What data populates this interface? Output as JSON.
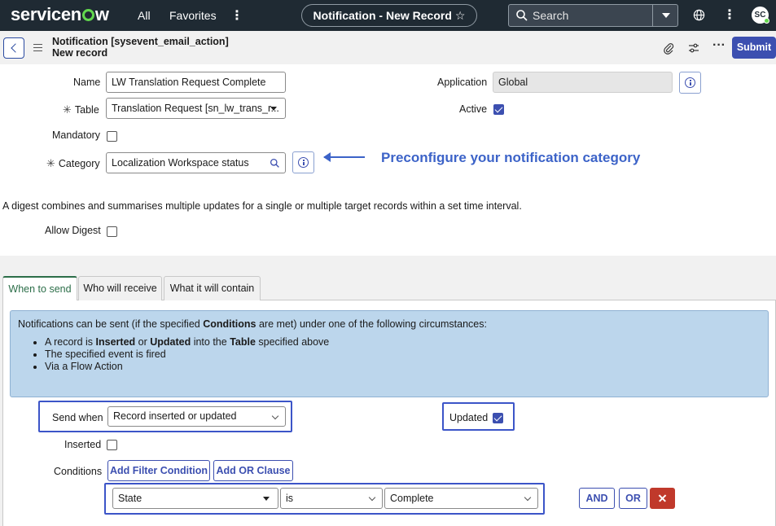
{
  "topnav": {
    "logo": "servicenow",
    "all": "All",
    "favorites": "Favorites",
    "more": "⋮",
    "page_title": "Notification - New Record",
    "search_label": "Search",
    "avatar_initials": "SC"
  },
  "header": {
    "table_label": "Notification [sysevent_email_action]",
    "record_label": "New record",
    "more": "···",
    "submit": "Submit"
  },
  "form": {
    "name_label": "Name",
    "name_value": "LW Translation Request Complete",
    "table_label": "Table",
    "table_value": "Translation Request [sn_lw_trans_r...",
    "application_label": "Application",
    "application_value": "Global",
    "active_label": "Active",
    "active_checked": true,
    "mandatory_label": "Mandatory",
    "mandatory_checked": false,
    "category_label": "Category",
    "category_value": "Localization Workspace status",
    "required_mark": "✳"
  },
  "annotation": "Preconfigure your notification category",
  "digest": {
    "description": "A digest combines and summarises multiple updates for a single or multiple target records within a set time interval.",
    "allow_label": "Allow Digest",
    "allow_checked": false
  },
  "tabs": [
    {
      "label": "When to send",
      "active": true
    },
    {
      "label": "Who will receive",
      "active": false
    },
    {
      "label": "What it will contain",
      "active": false
    }
  ],
  "when_to_send": {
    "intro_pre": "Notifications can be sent (if the specified ",
    "intro_bold": "Conditions",
    "intro_post": " are met) under one of the following circumstances:",
    "bullet1_a": "A record is ",
    "bullet1_b": "Inserted",
    "bullet1_c": " or ",
    "bullet1_d": "Updated",
    "bullet1_e": " into the ",
    "bullet1_f": "Table",
    "bullet1_g": " specified above",
    "bullet2": "The specified event is fired",
    "bullet3": "Via a Flow Action",
    "send_when_label": "Send when",
    "send_when_value": "Record inserted or updated",
    "updated_label": "Updated",
    "updated_checked": true,
    "inserted_label": "Inserted",
    "inserted_checked": false,
    "conditions_label": "Conditions",
    "add_filter": "Add Filter Condition",
    "add_or": "Add OR Clause",
    "cond_field": "State",
    "cond_operator": "is",
    "cond_value": "Complete",
    "and_btn": "AND",
    "or_btn": "OR"
  },
  "colors": {
    "nav_bg": "#1f2a33",
    "accent": "#3c4fb0",
    "annotation": "#3c63c8",
    "info_bg": "#bcd6ec",
    "delete": "#c0392b"
  }
}
